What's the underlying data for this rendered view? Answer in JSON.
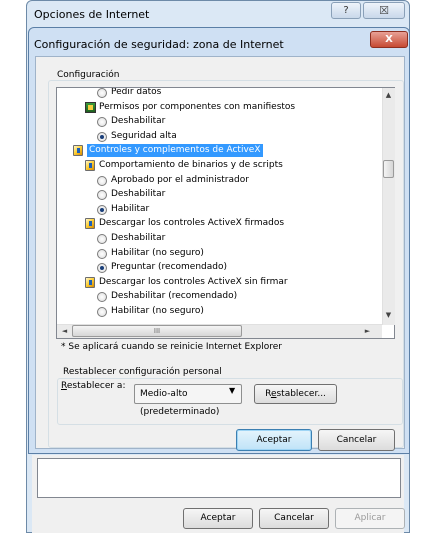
{
  "outer": {
    "title": "Opciones de Internet",
    "help_glyph": "?",
    "close_glyph": "☒",
    "buttons": {
      "ok": "Aceptar",
      "cancel": "Cancelar",
      "apply": "Aplicar"
    }
  },
  "dialog": {
    "title": "Configuración de seguridad: zona de Internet",
    "close_glyph": "X",
    "group_label": "Configuración",
    "tree": [
      {
        "type": "radio",
        "label": "Pedir datos",
        "checked": false,
        "indent": 2
      },
      {
        "type": "cert",
        "label": "Permisos por componentes con manifiestos",
        "indent": 1
      },
      {
        "type": "radio",
        "label": "Deshabilitar",
        "checked": false,
        "indent": 2
      },
      {
        "type": "radio",
        "label": "Seguridad alta",
        "checked": true,
        "indent": 2
      },
      {
        "type": "icon",
        "label": "Controles y complementos de ActiveX",
        "indent": 0,
        "selected": true
      },
      {
        "type": "icon",
        "label": "Comportamiento de binarios y de scripts",
        "indent": 1
      },
      {
        "type": "radio",
        "label": "Aprobado por el administrador",
        "checked": false,
        "indent": 2
      },
      {
        "type": "radio",
        "label": "Deshabilitar",
        "checked": false,
        "indent": 2
      },
      {
        "type": "radio",
        "label": "Habilitar",
        "checked": true,
        "indent": 2
      },
      {
        "type": "icon",
        "label": "Descargar los controles ActiveX firmados",
        "indent": 1
      },
      {
        "type": "radio",
        "label": "Deshabilitar",
        "checked": false,
        "indent": 2
      },
      {
        "type": "radio",
        "label": "Habilitar (no seguro)",
        "checked": false,
        "indent": 2
      },
      {
        "type": "radio",
        "label": "Preguntar (recomendado)",
        "checked": true,
        "indent": 2
      },
      {
        "type": "icon",
        "label": "Descargar los controles ActiveX sin firmar",
        "indent": 1
      },
      {
        "type": "radio",
        "label": "Deshabilitar (recomendado)",
        "checked": false,
        "indent": 2
      },
      {
        "type": "radio",
        "label": "Habilitar (no seguro)",
        "checked": false,
        "indent": 2
      }
    ],
    "scroll": {
      "up": "▲",
      "down": "▼",
      "left": "◄",
      "right": "►",
      "thumb_grip": "III"
    },
    "restart_note": "* Se aplicará cuando se reinicie Internet Explorer",
    "reset": {
      "legend": "Restablecer configuración personal",
      "label_first": "R",
      "label_rest": "establecer a:",
      "select_value": "Medio-alto (predeterminado)",
      "select_arrow": "▼",
      "button_first": "e",
      "button_label": "stablecer...",
      "button_prefix": "R"
    },
    "accept_label": "Aceptar",
    "cancel_label": "Cancelar"
  }
}
